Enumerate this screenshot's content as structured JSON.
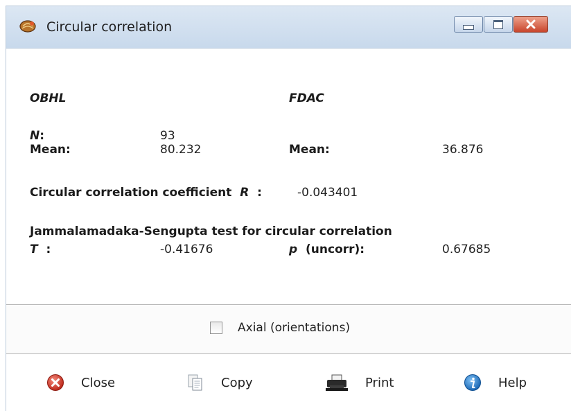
{
  "window": {
    "title": "Circular correlation",
    "controls": {
      "minimize_icon": "minimize-icon",
      "maximize_icon": "maximize-icon",
      "close_icon": "close-icon"
    }
  },
  "results": {
    "var1": "OBHL",
    "var2": "FDAC",
    "n_label": "N",
    "n_colon": ":",
    "n_value": "93",
    "mean_label": "Mean:",
    "mean1": "80.232",
    "mean2": "36.876",
    "corr_label": "Circular correlation coefficient",
    "corr_symbol": "R",
    "corr_colon": ":",
    "corr_value": "-0.043401",
    "test_title": "Jammalamadaka-Sengupta test for circular correlation",
    "t_label": "T",
    "t_colon": ":",
    "t_value": "-0.41676",
    "p_symbol": "p",
    "p_label": "(uncorr):",
    "p_value": "0.67685"
  },
  "options": {
    "axial_label": "Axial (orientations)",
    "axial_checked": false
  },
  "footer": {
    "close": {
      "label": "Close",
      "icon": "close-circle-icon"
    },
    "copy": {
      "label": "Copy",
      "icon": "copy-icon"
    },
    "print": {
      "label": "Print",
      "icon": "printer-icon"
    },
    "help": {
      "label": "Help",
      "icon": "info-icon"
    }
  },
  "colors": {
    "titlebar": "#c8d9ec",
    "close_button": "#c8452c",
    "help_blue": "#1e74c8",
    "close_red": "#d83a2a"
  }
}
